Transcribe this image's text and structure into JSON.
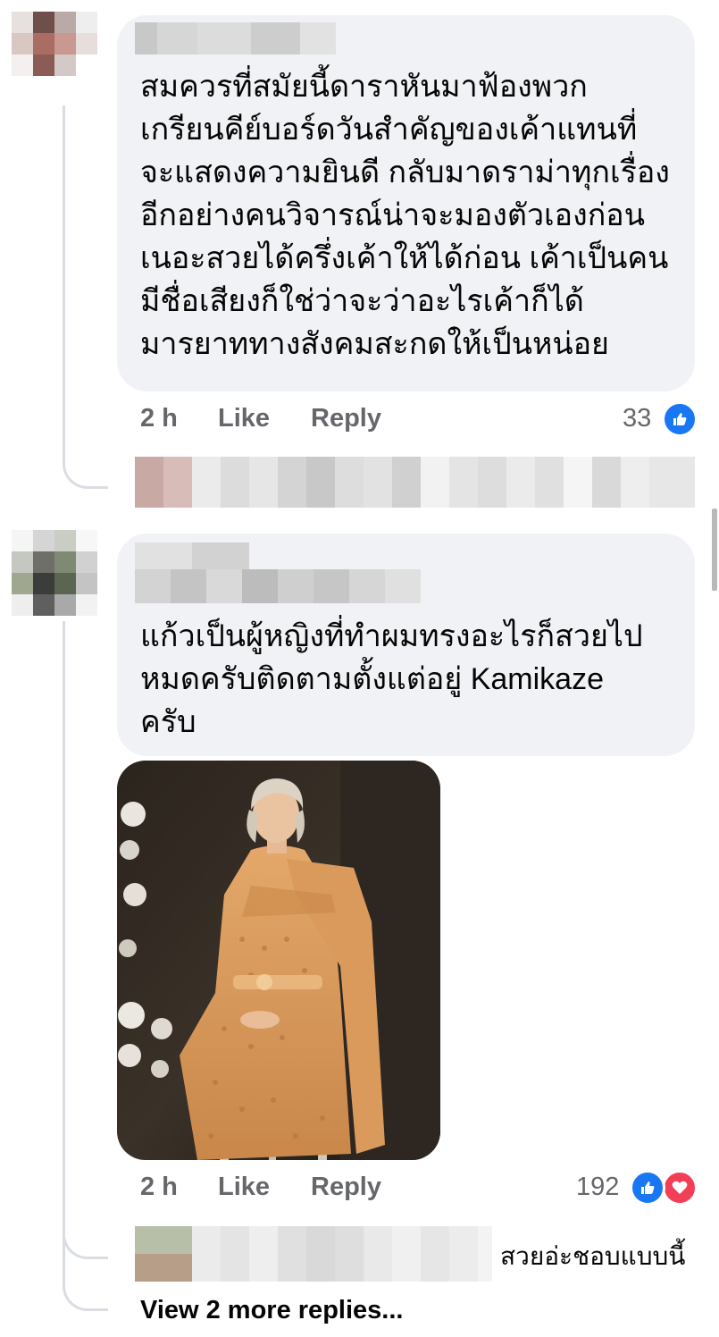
{
  "colors": {
    "bubble_bg": "#f0f2f5",
    "meta_text": "#65676b",
    "like_blue": "#1877f2",
    "love_red": "#f33e58"
  },
  "comments": [
    {
      "text": "สมควรที่สมัยนี้ดาราหันมาฟ้องพวก\nเกรียนคีย์บอร์ดวันสำคัญของเค้าแทนที่\nจะแสดงความยินดี กลับมาดราม่าทุกเรื่อง\nอีกอย่างคนวิจารณ์น่าจะมองตัวเองก่อน\nเนอะสวยได้ครึ่งเค้าให้ได้ก่อน เค้าเป็นคน\nมีชื่อเสียงก็ใช่ว่าจะว่าอะไรเค้าก็ได้\nมารยาททางสังคมสะกดให้เป็นหน่อย",
      "time": "2 h",
      "like_label": "Like",
      "reply_label": "Reply",
      "reaction_count": "33",
      "reactions": [
        "like-icon"
      ]
    },
    {
      "text": "แก้วเป็นผู้หญิงที่ทำผมทรงอะไรก็สวยไป\nหมดครับติดตามตั้งแต่อยู่ Kamikaze\nครับ",
      "time": "2 h",
      "like_label": "Like",
      "reply_label": "Reply",
      "reaction_count": "192",
      "reactions": [
        "like-icon",
        "love-icon"
      ],
      "reply_preview_text": "สวยอ่ะชอบแบบนี้",
      "view_more_label": "View 2 more replies..."
    }
  ]
}
